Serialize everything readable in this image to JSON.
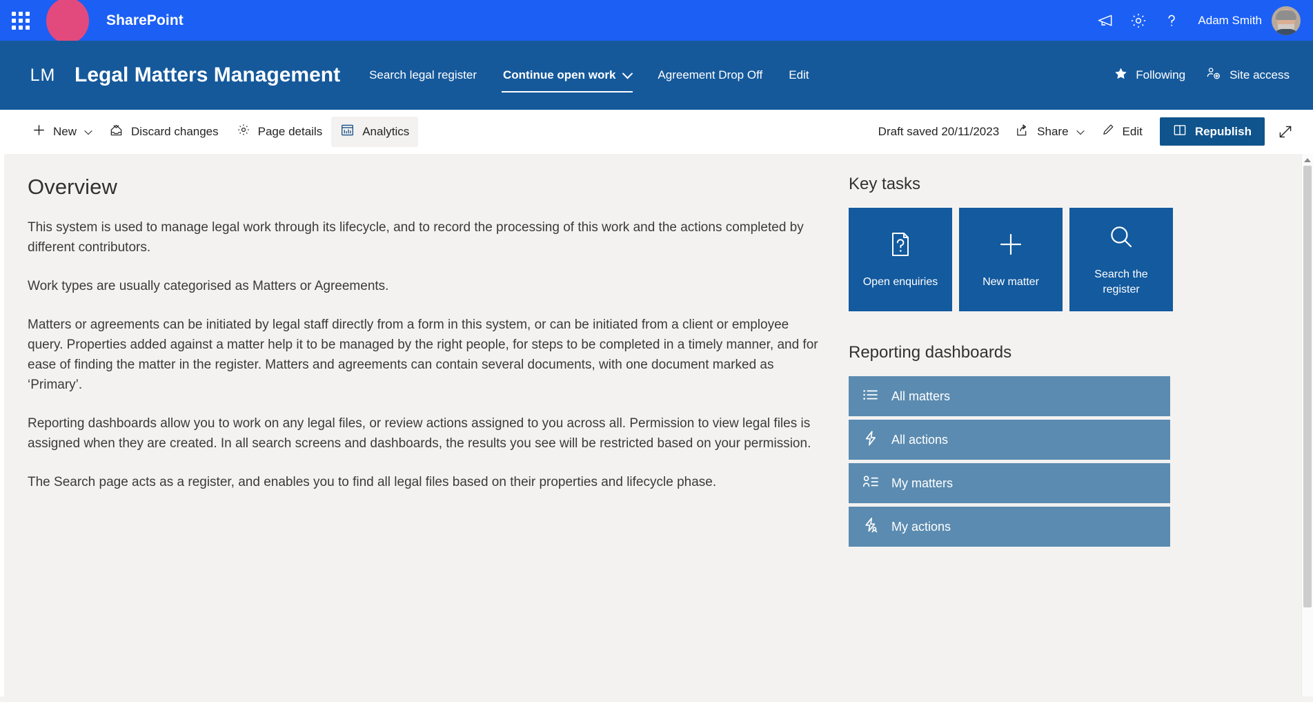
{
  "suite_bar": {
    "waffle_icon": "app-launcher-icon",
    "brand_blob": "brand-blob",
    "title": "SharePoint",
    "icons": [
      {
        "name": "megaphone-icon",
        "label": "Announcements"
      },
      {
        "name": "gear-icon",
        "label": "Settings"
      },
      {
        "name": "question-icon",
        "label": "Help"
      }
    ],
    "user_name": "Adam Smith",
    "avatar": "user-avatar",
    "background_color": "#1b5ff5",
    "blob_color": "#e24a7e"
  },
  "site_header": {
    "logo_initials": "LM",
    "site_title": "Legal Matters Management",
    "background_color": "#15599b",
    "nav": [
      {
        "label": "Search legal register",
        "selected": false,
        "has_chevron": false
      },
      {
        "label": "Continue open work",
        "selected": true,
        "has_chevron": true
      },
      {
        "label": "Agreement Drop Off",
        "selected": false,
        "has_chevron": false
      },
      {
        "label": "Edit",
        "selected": false,
        "has_chevron": false
      }
    ],
    "actions": [
      {
        "label": "Following",
        "icon": "star-icon"
      },
      {
        "label": "Site access",
        "icon": "people-add-icon"
      }
    ]
  },
  "command_bar": {
    "new_label": "New",
    "new_icon": "plus-icon",
    "discard_label": "Discard changes",
    "discard_icon": "discard-changes-icon",
    "page_details_label": "Page details",
    "page_details_icon": "gear-icon",
    "analytics_label": "Analytics",
    "analytics_icon": "analytics-icon",
    "draft_status": "Draft saved 20/11/2023",
    "share_label": "Share",
    "share_icon": "share-icon",
    "edit_label": "Edit",
    "edit_icon": "pencil-icon",
    "republish_label": "Republish",
    "republish_icon": "republish-icon",
    "republish_color": "#0f548c",
    "expand_icon": "expand-icon"
  },
  "main": {
    "heading": "Overview",
    "paragraphs": [
      "This system is used to manage legal work through its lifecycle, and to record the processing of this work and the actions completed by different contributors.",
      "Work types are usually categorised as Matters or Agreements.",
      "Matters or agreements can be initiated by legal staff directly from a form in this system, or can be initiated from a client or employee query.  Properties added against a matter help it to be managed by the right people, for steps to be completed in a timely manner, and for ease of finding the matter in the register. Matters and agreements can contain several documents, with one document marked as ‘Primary’.",
      "Reporting dashboards allow you to work on any legal files, or review actions assigned to you across all. Permission to view legal files is assigned when they are created. In all search screens and dashboards, the results you see will be restricted based on your permission.",
      "The Search page acts as a register, and enables you to find all legal files based on their properties and lifecycle phase."
    ]
  },
  "side": {
    "key_tasks": {
      "heading": "Key tasks",
      "tile_color": "#135a9e",
      "tiles": [
        {
          "label": "Open enquiries",
          "icon": "document-question-icon"
        },
        {
          "label": "New matter",
          "icon": "plus-icon"
        },
        {
          "label": "Search the register",
          "icon": "search-icon"
        }
      ]
    },
    "reporting": {
      "heading": "Reporting dashboards",
      "item_color": "#5b8bb0",
      "items": [
        {
          "label": "All matters",
          "icon": "bulleted-list-icon"
        },
        {
          "label": "All actions",
          "icon": "lightning-icon"
        },
        {
          "label": "My matters",
          "icon": "person-list-icon"
        },
        {
          "label": "My actions",
          "icon": "lightning-person-icon"
        }
      ]
    }
  },
  "scrollbar": {
    "up_arrow": "scroll-up-arrow",
    "thumb": "scroll-thumb"
  }
}
